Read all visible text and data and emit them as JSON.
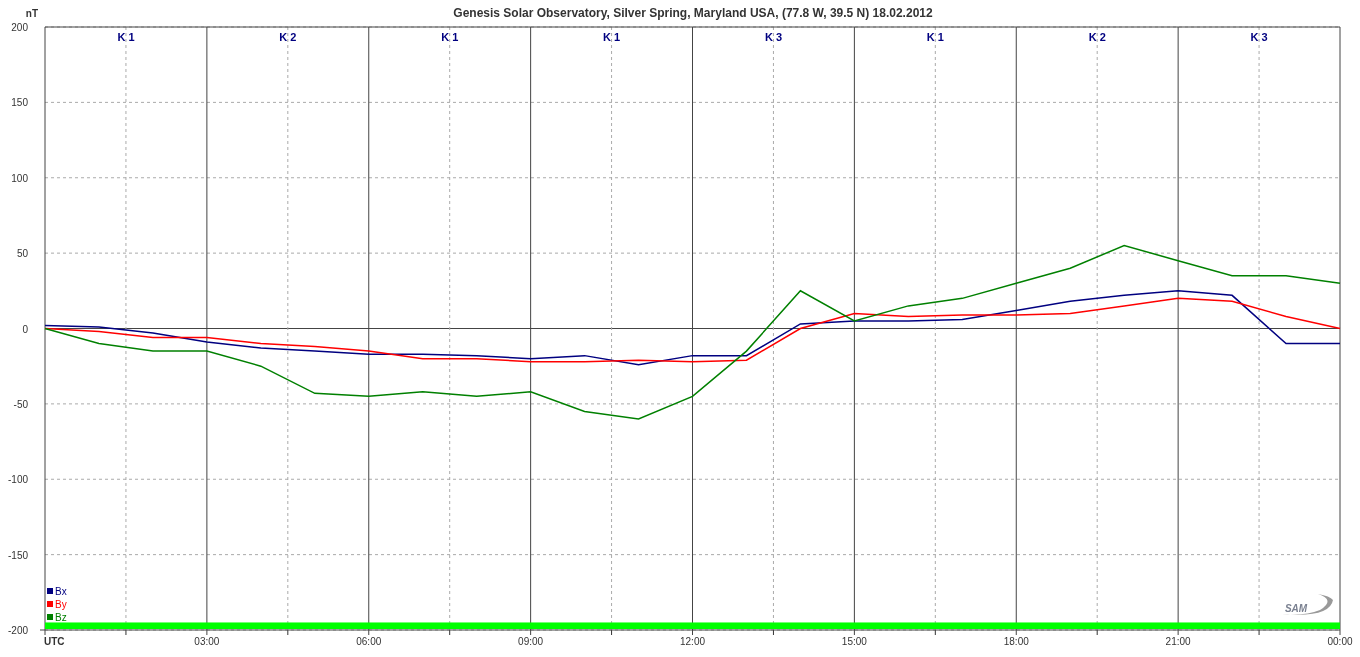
{
  "chart_data": {
    "type": "line",
    "title": "Genesis Solar Observatory, Silver Spring, Maryland USA, (77.8 W, 39.5 N)  18.02.2012",
    "ylabel": "nT",
    "x": [
      0,
      1,
      2,
      3,
      4,
      5,
      6,
      7,
      8,
      9,
      10,
      11,
      12,
      13,
      14,
      15,
      16,
      17,
      18,
      19,
      20,
      21,
      22,
      23,
      24
    ],
    "xlim": [
      0,
      24
    ],
    "ylim": [
      -200,
      200
    ],
    "xticks": [
      {
        "value": 0,
        "label": "UTC"
      },
      {
        "value": 3,
        "label": "03:00"
      },
      {
        "value": 6,
        "label": "06:00"
      },
      {
        "value": 9,
        "label": "09:00"
      },
      {
        "value": 12,
        "label": "12:00"
      },
      {
        "value": 15,
        "label": "15:00"
      },
      {
        "value": 18,
        "label": "18:00"
      },
      {
        "value": 21,
        "label": "21:00"
      },
      {
        "value": 24,
        "label": "00:00"
      }
    ],
    "yticks": [
      -200,
      -150,
      -100,
      -50,
      0,
      50,
      100,
      150,
      200
    ],
    "grid": true,
    "legend": true,
    "bands": [
      {
        "axis": "y",
        "from": -200,
        "to": -195,
        "color": "#00ff00"
      }
    ],
    "series": [
      {
        "name": "Bx",
        "color": "#000080",
        "values": [
          2,
          1,
          -3,
          -9,
          -13,
          -15,
          -17,
          -17,
          -18,
          -20,
          -18,
          -24,
          -18,
          -18,
          3,
          5,
          5,
          6,
          12,
          18,
          22,
          25,
          22,
          -10,
          -10
        ]
      },
      {
        "name": "By",
        "color": "#ff0000",
        "values": [
          0,
          -2,
          -6,
          -6,
          -10,
          -12,
          -15,
          -20,
          -20,
          -22,
          -22,
          -21,
          -22,
          -21,
          0,
          10,
          8,
          9,
          9,
          10,
          15,
          20,
          18,
          8,
          0
        ]
      },
      {
        "name": "Bz",
        "color": "#008000",
        "values": [
          0,
          -10,
          -15,
          -15,
          -25,
          -43,
          -45,
          -42,
          -45,
          -42,
          -55,
          -60,
          -45,
          -15,
          25,
          5,
          15,
          20,
          30,
          40,
          55,
          45,
          35,
          35,
          30
        ]
      }
    ]
  },
  "k_indices": [
    "K 1",
    "K 2",
    "K 1",
    "K 1",
    "K 3",
    "K 1",
    "K 2",
    "K 3"
  ],
  "logo_text": "SAM"
}
